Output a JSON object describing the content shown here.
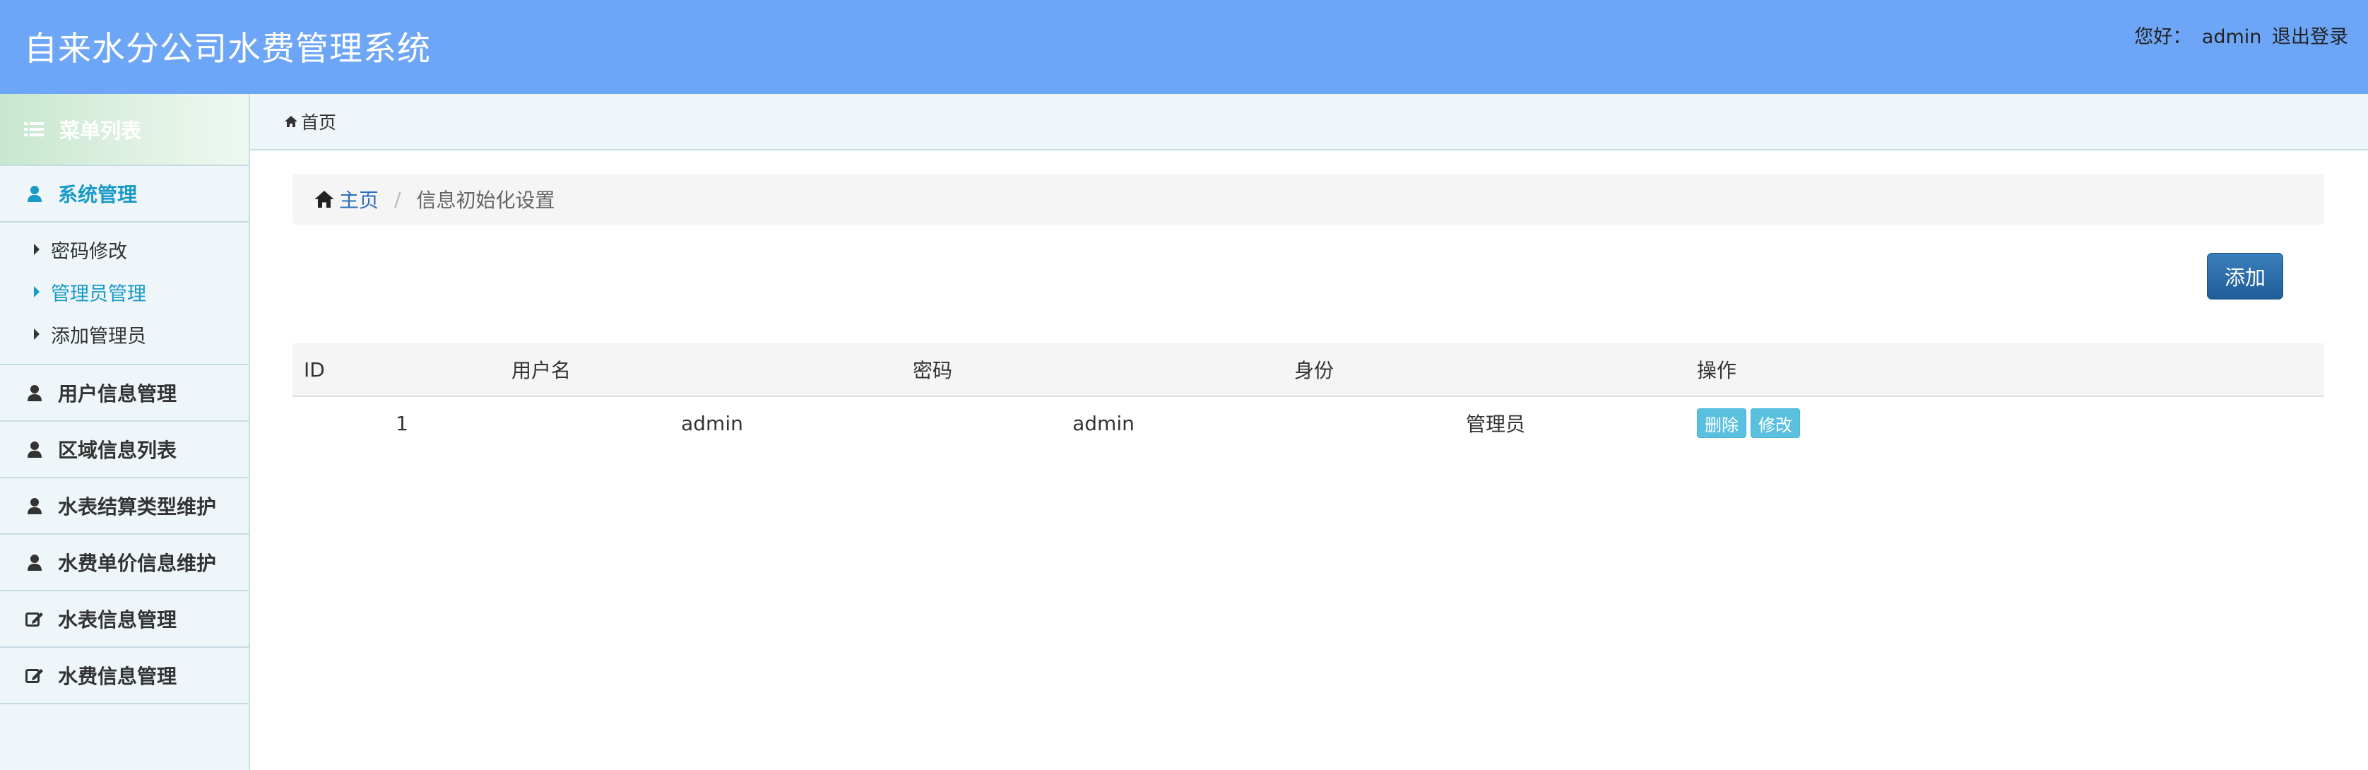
{
  "header": {
    "title": "自来水分公司水费管理系统",
    "greeting": "您好：",
    "username": "admin",
    "logout_label": "退出登录"
  },
  "sidebar": {
    "heading": "菜单列表",
    "groups": [
      {
        "label": "系统管理",
        "icon": "user-icon",
        "active": true,
        "items": [
          {
            "label": "密码修改"
          },
          {
            "label": "管理员管理",
            "active": true
          },
          {
            "label": "添加管理员"
          }
        ]
      },
      {
        "label": "用户信息管理",
        "icon": "user-icon"
      },
      {
        "label": "区域信息列表",
        "icon": "user-icon"
      },
      {
        "label": "水表结算类型维护",
        "icon": "user-icon"
      },
      {
        "label": "水费单价信息维护",
        "icon": "user-icon"
      },
      {
        "label": "水表信息管理",
        "icon": "edit-icon"
      },
      {
        "label": "水费信息管理",
        "icon": "edit-icon"
      }
    ]
  },
  "topbar": {
    "home_label": "首页"
  },
  "breadcrumb": {
    "home_label": "主页",
    "separator": "/",
    "current": "信息初始化设置"
  },
  "toolbar": {
    "add_label": "添加"
  },
  "table": {
    "headers": [
      "ID",
      "用户名",
      "密码",
      "身份",
      "操作"
    ],
    "rows": [
      {
        "id": "1",
        "username": "admin",
        "password": "admin",
        "role": "管理员",
        "actions": {
          "delete": "删除",
          "edit": "修改"
        }
      }
    ]
  },
  "colors": {
    "header_bg": "#6ea6f7",
    "accent": "#1a9ac9",
    "primary_button": "#2a6ca8",
    "info_button": "#5bc0de"
  }
}
